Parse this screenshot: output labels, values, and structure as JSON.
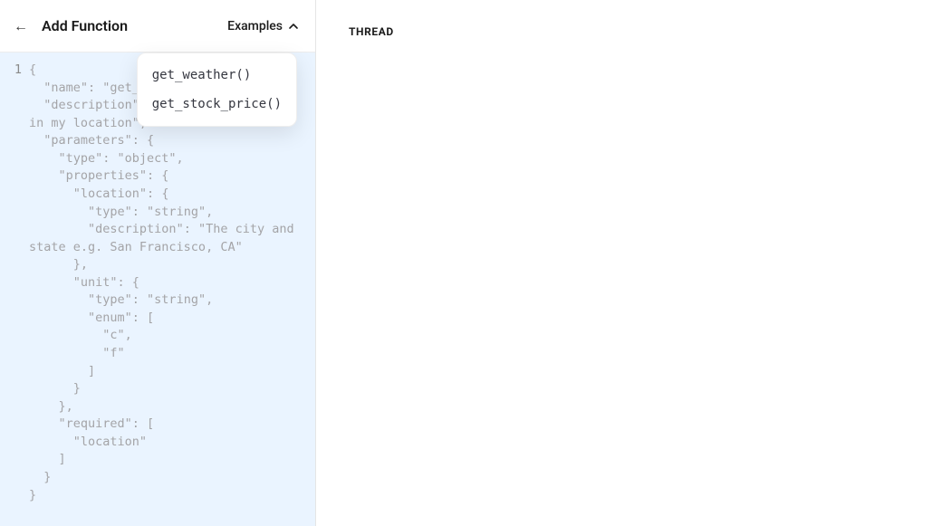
{
  "header": {
    "back_icon": "←",
    "title": "Add Function",
    "examples_label": "Examples"
  },
  "examples_menu": {
    "items": [
      {
        "label": "get_weather()"
      },
      {
        "label": "get_stock_price()"
      }
    ]
  },
  "code": {
    "first_line_number": "1",
    "text": "{\n  \"name\": \"get_weather\",\n  \"description\": \"Determine weather in my location\",\n  \"parameters\": {\n    \"type\": \"object\",\n    \"properties\": {\n      \"location\": {\n        \"type\": \"string\",\n        \"description\": \"The city and state e.g. San Francisco, CA\"\n      },\n      \"unit\": {\n        \"type\": \"string\",\n        \"enum\": [\n          \"c\",\n          \"f\"\n        ]\n      }\n    },\n    \"required\": [\n      \"location\"\n    ]\n  }\n}"
  },
  "right": {
    "thread_label": "THREAD"
  }
}
